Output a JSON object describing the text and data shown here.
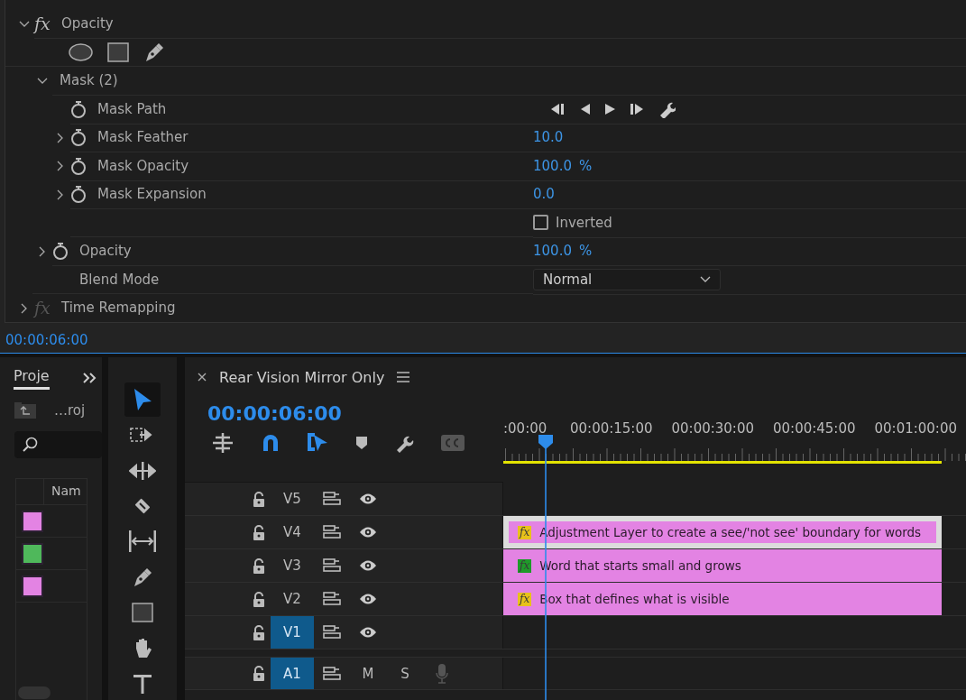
{
  "effect_controls": {
    "effects": [
      {
        "kind": "effect",
        "label": "Opacity",
        "expanded": true,
        "fx_on": true,
        "fx_label": "fx",
        "children": [
          {
            "kind": "mask_tools"
          },
          {
            "kind": "group",
            "label": "Mask (2)",
            "expanded": true,
            "children": [
              {
                "kind": "path",
                "label": "Mask Path"
              },
              {
                "kind": "param",
                "label": "Mask Feather",
                "expanded": false,
                "value": "10.0"
              },
              {
                "kind": "param",
                "label": "Mask Opacity",
                "expanded": false,
                "value": "100.0",
                "unit": "%"
              },
              {
                "kind": "param",
                "label": "Mask Expansion",
                "expanded": false,
                "value": "0.0"
              },
              {
                "kind": "checkbox",
                "label": "Inverted",
                "checked": false
              }
            ]
          },
          {
            "kind": "param",
            "label": "Opacity",
            "expanded": false,
            "value": "100.0",
            "unit": "%"
          },
          {
            "kind": "dropdown",
            "label": "Blend Mode",
            "value": "Normal"
          }
        ]
      },
      {
        "kind": "effect",
        "label": "Time Remapping",
        "expanded": false,
        "fx_on": false,
        "fx_label": "fx"
      }
    ],
    "timecode": "00:00:06:00"
  },
  "project": {
    "tab": "Proje",
    "folder": "…roj",
    "column": "Nam",
    "items": [
      {
        "color": "#e383e3"
      },
      {
        "color": "#4fb85b"
      },
      {
        "color": "#e383e3"
      }
    ]
  },
  "tools": [
    {
      "kind": "selection",
      "selected": true
    },
    {
      "kind": "track_select",
      "selected": false
    },
    {
      "kind": "ripple",
      "selected": false
    },
    {
      "kind": "razor",
      "selected": false
    },
    {
      "kind": "slip",
      "selected": false
    },
    {
      "kind": "pen",
      "selected": false
    },
    {
      "kind": "rectangle",
      "selected": false
    },
    {
      "kind": "hand",
      "selected": false
    },
    {
      "kind": "type",
      "selected": false
    }
  ],
  "timeline": {
    "title": "Rear Vision Mirror Only",
    "timecode": "00:00:06:00",
    "toolbar": [
      {
        "kind": "insert",
        "on": false
      },
      {
        "kind": "snap",
        "on": true
      },
      {
        "kind": "linked",
        "on": true
      },
      {
        "kind": "marker",
        "on": false
      },
      {
        "kind": "settings",
        "on": false
      },
      {
        "kind": "captions",
        "on": false
      }
    ],
    "ruler": [
      ":00:00",
      "00:00:15:00",
      "00:00:30:00",
      "00:00:45:00",
      "00:01:00:00"
    ],
    "tracks": [
      {
        "kind": "video",
        "name": "V5",
        "targeted": false
      },
      {
        "kind": "video",
        "name": "V4",
        "targeted": false,
        "clip": {
          "label": "Adjustment Layer to create a see/'not see' boundary for words",
          "badge": {
            "text": "fx",
            "color": "#e8c21a"
          },
          "selected": true
        }
      },
      {
        "kind": "video",
        "name": "V3",
        "targeted": false,
        "clip": {
          "label": "Word that starts small and grows",
          "badge": {
            "text": "fx",
            "color": "#1f9a2a"
          },
          "selected": false
        }
      },
      {
        "kind": "video",
        "name": "V2",
        "targeted": false,
        "clip": {
          "label": "Box that defines what is visible",
          "badge": {
            "text": "fx",
            "color": "#e8c21a"
          },
          "selected": false
        }
      },
      {
        "kind": "video",
        "name": "V1",
        "targeted": true
      },
      {
        "kind": "audio",
        "name": "A1",
        "targeted": true,
        "mute": "M",
        "solo": "S"
      }
    ]
  }
}
